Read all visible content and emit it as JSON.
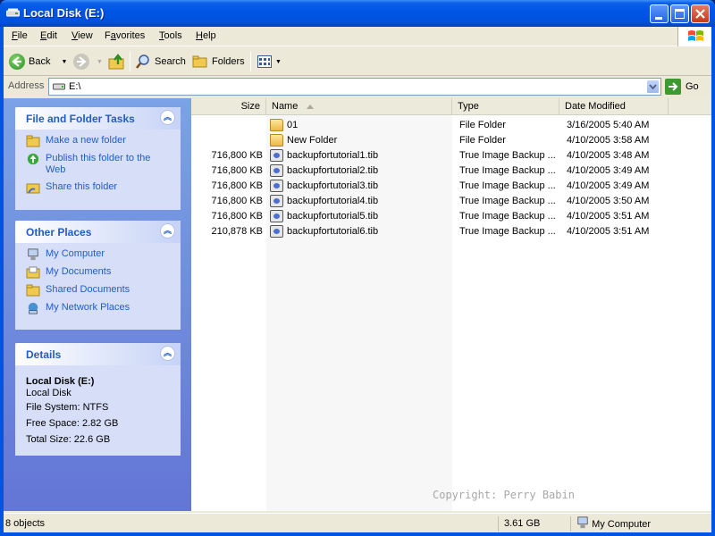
{
  "window": {
    "title": "Local Disk (E:)"
  },
  "menu": [
    {
      "key": "F",
      "rest": "ile"
    },
    {
      "key": "E",
      "rest": "dit"
    },
    {
      "key": "V",
      "rest": "iew"
    },
    {
      "key": "",
      "pre": "F",
      "u": "a",
      "rest": "vorites"
    },
    {
      "key": "T",
      "rest": "ools"
    },
    {
      "key": "H",
      "rest": "elp"
    }
  ],
  "menu_labels": {
    "file_u": "F",
    "file": "ile",
    "edit_u": "E",
    "edit": "dit",
    "view_u": "V",
    "view": "iew",
    "fav_pre": "F",
    "fav_u": "a",
    "fav": "vorites",
    "tools_u": "T",
    "tools": "ools",
    "help_u": "H",
    "help": "elp"
  },
  "toolbar": {
    "back": "Back",
    "search": "Search",
    "folders": "Folders"
  },
  "address": {
    "label": "Address",
    "value": "E:\\",
    "go": "Go"
  },
  "tasks": {
    "file_folder": {
      "title": "File and Folder Tasks",
      "items": [
        "Make a new folder",
        "Publish this folder to the Web",
        "Share this folder"
      ]
    },
    "other_places": {
      "title": "Other Places",
      "items": [
        "My Computer",
        "My Documents",
        "Shared Documents",
        "My Network Places"
      ]
    },
    "details": {
      "title": "Details",
      "name": "Local Disk (E:)",
      "kind": "Local Disk",
      "filesystem": "File System: NTFS",
      "free": "Free Space: 2.82 GB",
      "total": "Total Size: 22.6 GB"
    }
  },
  "columns": {
    "size": "Size",
    "name": "Name",
    "type": "Type",
    "date": "Date Modified"
  },
  "files": [
    {
      "size": "",
      "name": "01",
      "type": "File Folder",
      "date": "3/16/2005 5:40 AM",
      "icon": "folder-icon"
    },
    {
      "size": "",
      "name": "New Folder",
      "type": "File Folder",
      "date": "4/10/2005 3:58 AM",
      "icon": "folder-icon"
    },
    {
      "size": "716,800 KB",
      "name": "backupfortutorial1.tib",
      "type": "True Image Backup ...",
      "date": "4/10/2005 3:48 AM",
      "icon": "tib-file-icon"
    },
    {
      "size": "716,800 KB",
      "name": "backupfortutorial2.tib",
      "type": "True Image Backup ...",
      "date": "4/10/2005 3:49 AM",
      "icon": "tib-file-icon"
    },
    {
      "size": "716,800 KB",
      "name": "backupfortutorial3.tib",
      "type": "True Image Backup ...",
      "date": "4/10/2005 3:49 AM",
      "icon": "tib-file-icon"
    },
    {
      "size": "716,800 KB",
      "name": "backupfortutorial4.tib",
      "type": "True Image Backup ...",
      "date": "4/10/2005 3:50 AM",
      "icon": "tib-file-icon"
    },
    {
      "size": "716,800 KB",
      "name": "backupfortutorial5.tib",
      "type": "True Image Backup ...",
      "date": "4/10/2005 3:51 AM",
      "icon": "tib-file-icon"
    },
    {
      "size": "210,878 KB",
      "name": "backupfortutorial6.tib",
      "type": "True Image Backup ...",
      "date": "4/10/2005 3:51 AM",
      "icon": "tib-file-icon"
    }
  ],
  "watermark": "Copyright: Perry Babin",
  "status": {
    "objects": "8 objects",
    "free": "3.61 GB",
    "location": "My Computer"
  },
  "colors": {
    "title_bar": "#0055e5",
    "link": "#215dc6",
    "pane": "#7ba2e7"
  }
}
